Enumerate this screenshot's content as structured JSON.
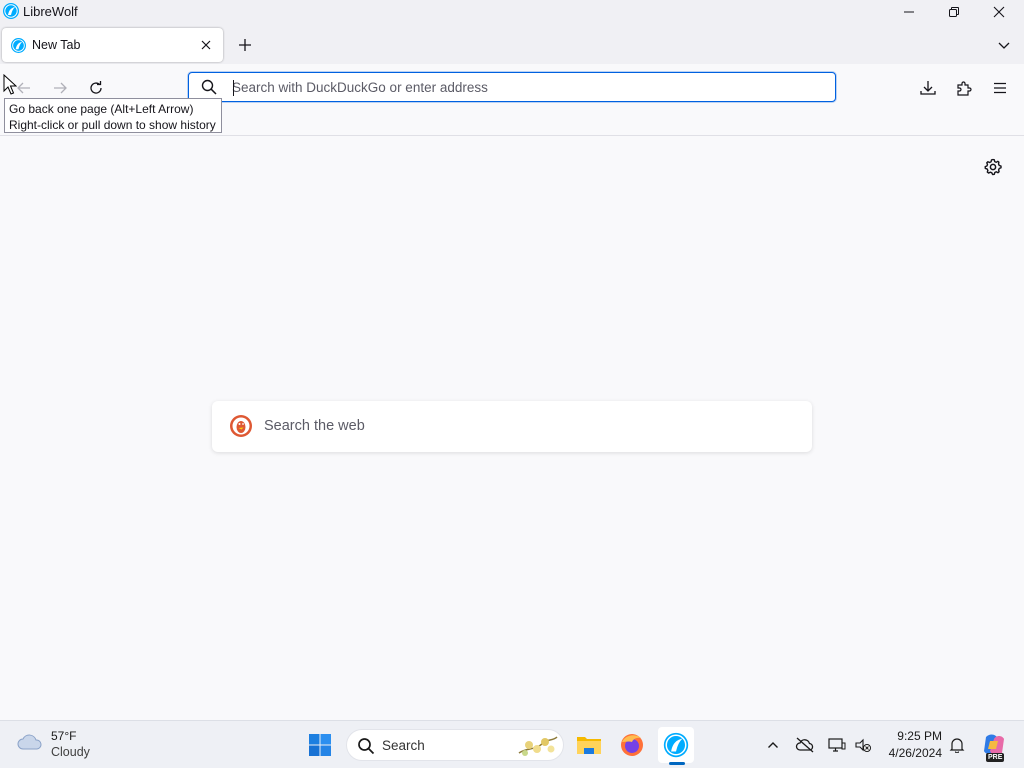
{
  "window": {
    "title": "LibreWolf",
    "controls": {
      "minimize": "minimize-icon",
      "maximize": "restore-icon",
      "close": "close-icon"
    }
  },
  "tabs": [
    {
      "label": "New Tab",
      "active": true,
      "icon": "librewolf-icon"
    }
  ],
  "toolbar": {
    "back_icon": "arrow-left-icon",
    "forward_icon": "arrow-right-icon",
    "reload_icon": "reload-icon",
    "url_placeholder": "Search with DuckDuckGo or enter address",
    "url_value": "",
    "downloads_icon": "download-icon",
    "extensions_icon": "puzzle-icon",
    "menu_icon": "hamburger-icon"
  },
  "tooltip": {
    "line1": "Go back one page (Alt+Left Arrow)",
    "line2": "Right-click or pull down to show history"
  },
  "content": {
    "search_placeholder": "Search the web",
    "settings_icon": "gear-icon"
  },
  "taskbar": {
    "weather": {
      "temp": "57°F",
      "condition": "Cloudy"
    },
    "search_label": "Search",
    "apps": [
      "file-explorer",
      "firefox",
      "librewolf"
    ],
    "clock": {
      "time": "9:25 PM",
      "date": "4/26/2024"
    },
    "copilot_badge": "PRE"
  },
  "colors": {
    "accent": "#0061e0",
    "librewolf": "#00acff",
    "page_bg": "#f9f9fb",
    "chrome_bg": "#f0f0f4",
    "ddg_orange": "#de5833"
  }
}
